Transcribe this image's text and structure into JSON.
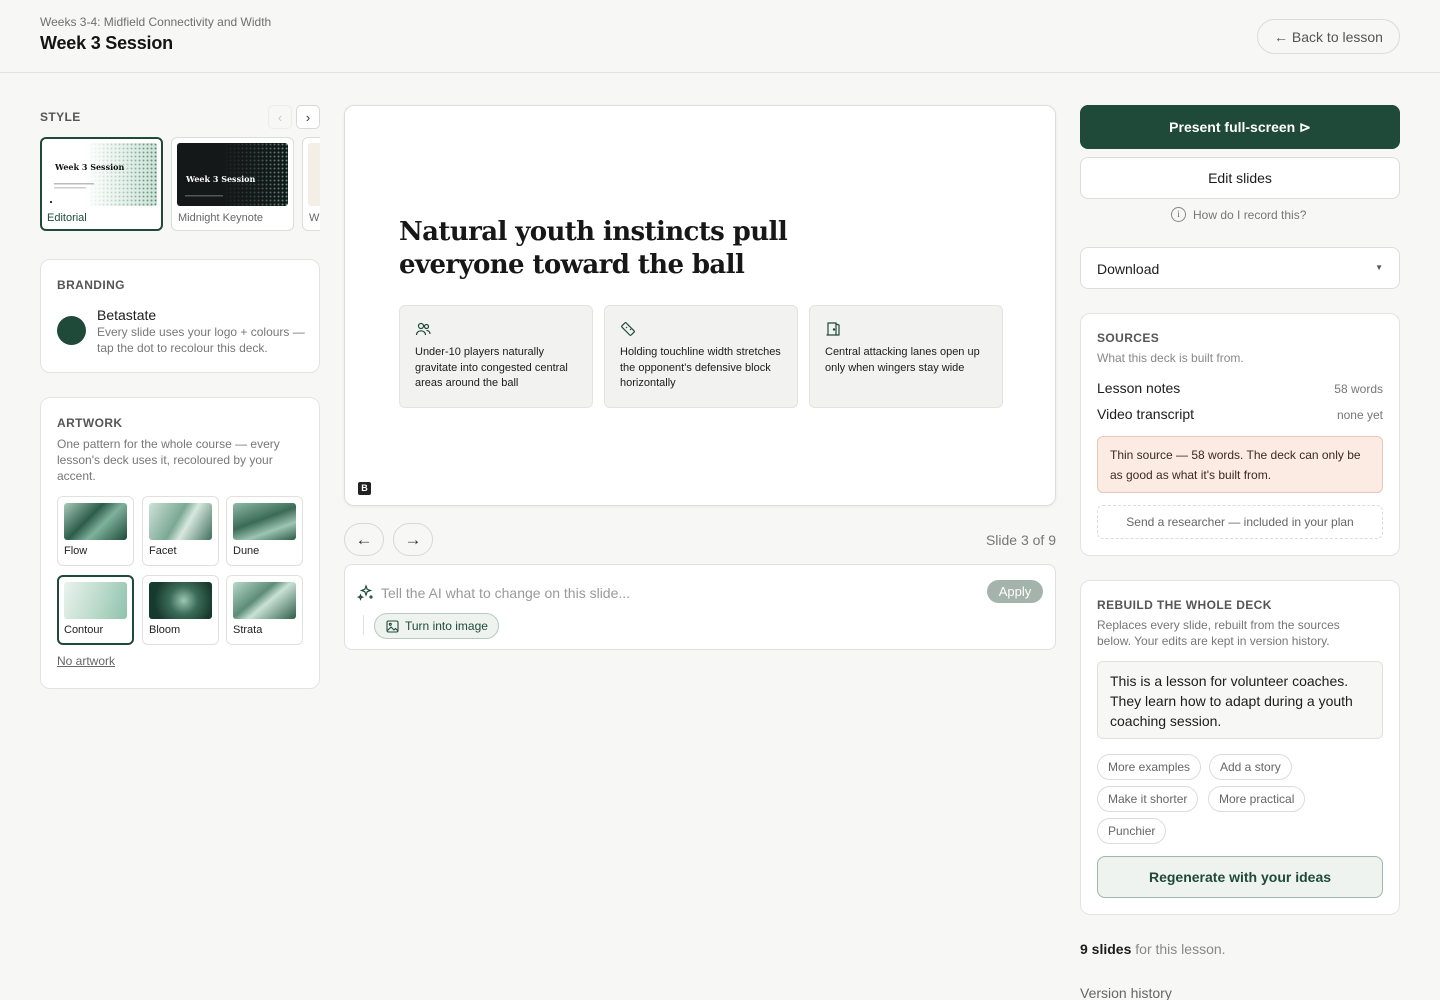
{
  "header": {
    "breadcrumb": "Weeks 3-4: Midfield Connectivity and Width",
    "title": "Week 3 Session",
    "back_label": "← Back to lesson"
  },
  "style": {
    "label": "STYLE",
    "prev_icon": "chevron-left-icon",
    "next_icon": "chevron-right-icon",
    "thumb_text": "Week 3 Session",
    "options": [
      {
        "name": "Editorial",
        "selected": true
      },
      {
        "name": "Midnight Keynote",
        "selected": false
      },
      {
        "name": "W",
        "selected": false
      }
    ]
  },
  "branding": {
    "label": "BRANDING",
    "name": "Betastate",
    "description": "Every slide uses your logo + colours — tap the dot to recolour this deck.",
    "color": "#1f4a3a"
  },
  "artwork": {
    "label": "ARTWORK",
    "description": "One pattern for the whole course — every lesson's deck uses it, recoloured by your accent.",
    "options": [
      {
        "name": "Flow",
        "selected": false
      },
      {
        "name": "Facet",
        "selected": false
      },
      {
        "name": "Dune",
        "selected": false
      },
      {
        "name": "Contour",
        "selected": true
      },
      {
        "name": "Bloom",
        "selected": false
      },
      {
        "name": "Strata",
        "selected": false
      }
    ],
    "no_artwork": "No artwork"
  },
  "slide": {
    "headline": "Natural youth instincts pull everyone toward the ball",
    "cards": [
      {
        "icon": "users-icon",
        "text": "Under-10 players naturally gravitate into congested central areas around the ball"
      },
      {
        "icon": "ruler-icon",
        "text": "Holding touchline width stretches the opponent's defensive block horizontally"
      },
      {
        "icon": "door-icon",
        "text": "Central attacking lanes open up only when wingers stay wide"
      }
    ],
    "logo_letter": "B",
    "counter": "Slide 3 of 9"
  },
  "nav": {
    "prev": "←",
    "next": "→"
  },
  "ai": {
    "placeholder": "Tell the AI what to change on this slide...",
    "apply": "Apply",
    "turn_into_image": "Turn into image"
  },
  "actions": {
    "present": "Present full-screen ⊳",
    "edit": "Edit slides",
    "how_record": "How do I record this?",
    "download": "Download"
  },
  "sources": {
    "label": "SOURCES",
    "subtitle": "What this deck is built from.",
    "rows": [
      {
        "name": "Lesson notes",
        "value": "58 words"
      },
      {
        "name": "Video transcript",
        "value": "none yet"
      }
    ],
    "warning": "Thin source — 58 words. The deck can only be as good as what it's built from.",
    "researcher": "Send a researcher — included in your plan"
  },
  "rebuild": {
    "label": "REBUILD THE WHOLE DECK",
    "description": "Replaces every slide, rebuilt from the sources below. Your edits are kept in version history.",
    "text": "This is a lesson for volunteer coaches. They learn how to adapt during a youth coaching session.",
    "chips": [
      "More examples",
      "Add a story",
      "Make it shorter",
      "More practical",
      "Punchier"
    ],
    "regenerate": "Regenerate with your ideas"
  },
  "footer": {
    "slides_count": "9 slides",
    "slides_suffix": " for this lesson.",
    "version_history": "Version history"
  },
  "colors": {
    "accent": "#1f4a3a",
    "warning_bg": "#fbebe3"
  }
}
